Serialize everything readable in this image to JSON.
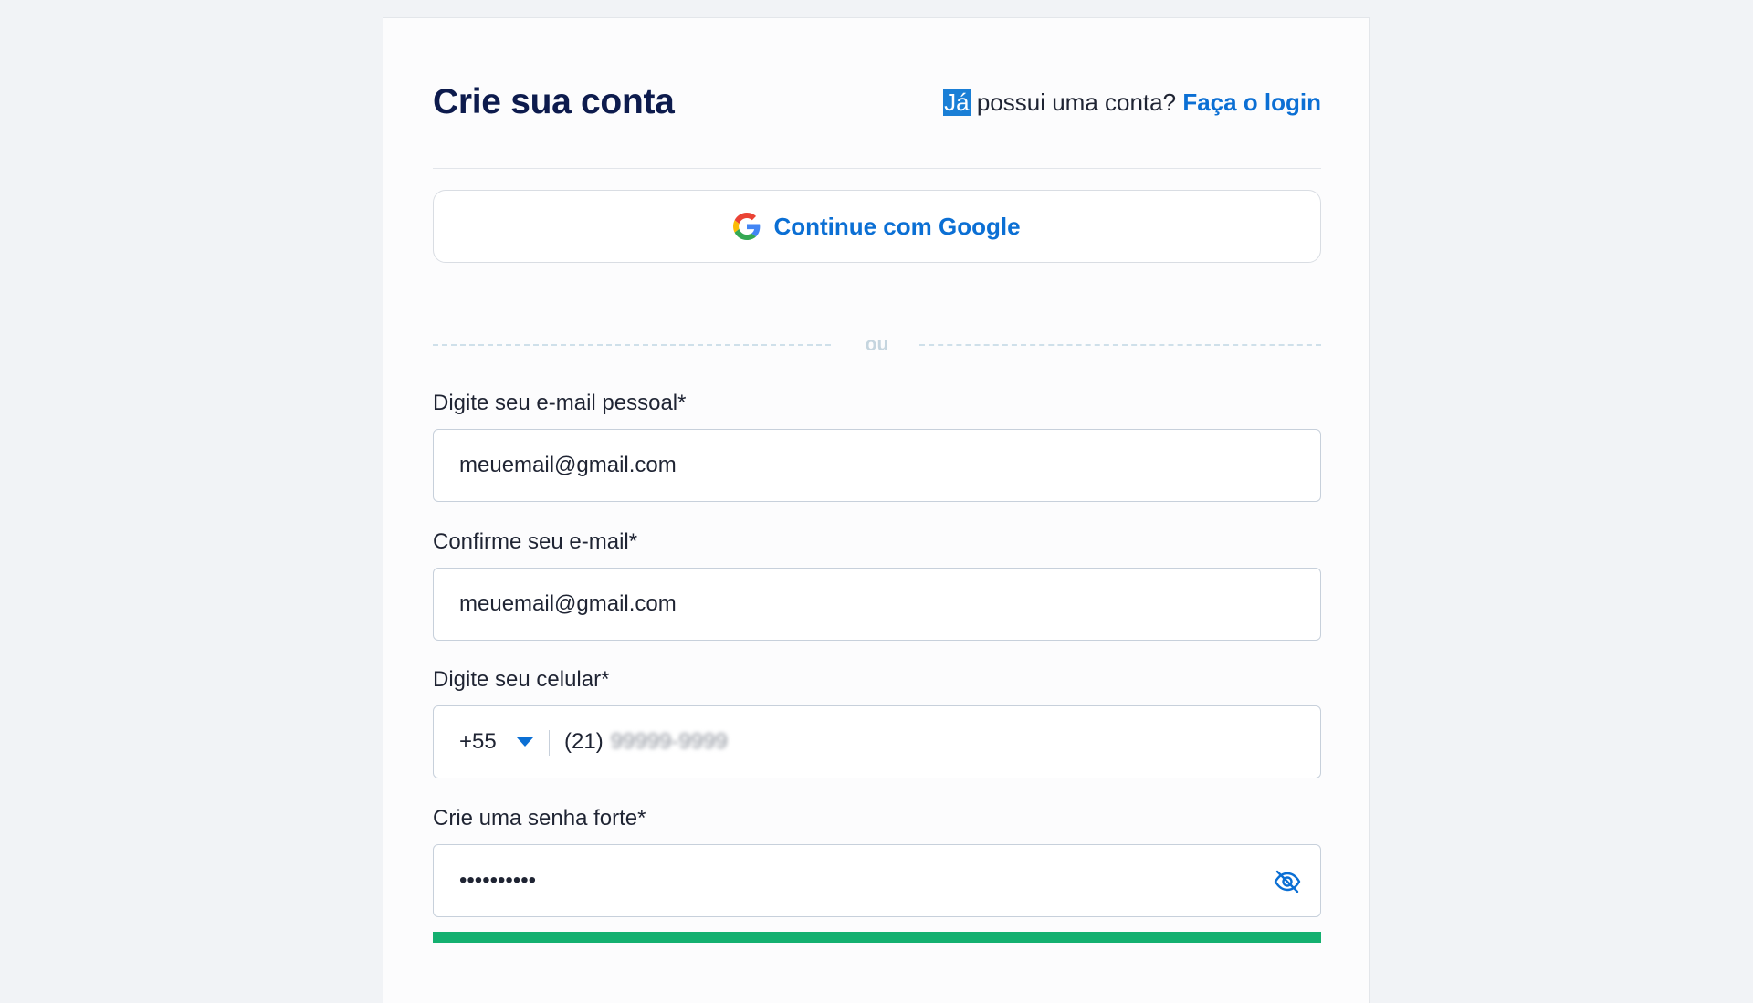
{
  "header": {
    "title": "Crie sua conta",
    "login_prompt_highlight": "Já",
    "login_prompt_text": " possui uma conta? ",
    "login_link": "Faça o login"
  },
  "google_button": {
    "icon": "google-g-icon",
    "label": "Continue com Google"
  },
  "separator": {
    "label": "ou"
  },
  "form": {
    "email": {
      "label": "Digite seu e-mail pessoal*",
      "value": "meuemail@gmail.com"
    },
    "email_confirm": {
      "label": "Confirme seu e-mail*",
      "value": "meuemail@gmail.com"
    },
    "phone": {
      "label": "Digite seu celular*",
      "country_code": "+55",
      "area_code": "(21)",
      "number_masked": "99999-9999"
    },
    "password": {
      "label": "Crie uma senha forte*",
      "value_masked": "••••••••••",
      "visibility_icon": "eye-off-icon",
      "strength_fraction": 1.0
    }
  },
  "colors": {
    "accent": "#0b6fd4",
    "title": "#0d1b4d",
    "strength_strong": "#14b070"
  }
}
